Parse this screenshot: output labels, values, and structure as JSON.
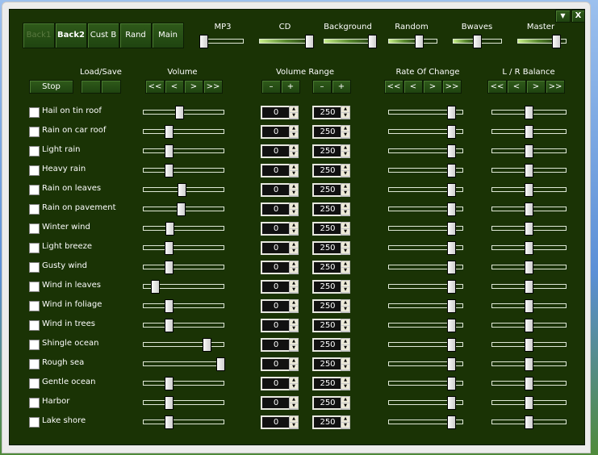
{
  "top_buttons": [
    {
      "label": "Back1",
      "disabled": true
    },
    {
      "label": "Back2",
      "bold": true
    },
    {
      "label": "Cust B"
    },
    {
      "label": "Rand"
    },
    {
      "label": "Main"
    }
  ],
  "window_controls": {
    "menu": "▼",
    "close": "X"
  },
  "mixer": [
    {
      "label": "MP3",
      "value": 0
    },
    {
      "label": "CD",
      "value": 100
    },
    {
      "label": "Background",
      "value": 100
    },
    {
      "label": "Random",
      "value": 65
    },
    {
      "label": "Bwaves",
      "value": 50
    },
    {
      "label": "Master",
      "value": 85
    }
  ],
  "controls": {
    "stop": "Stop",
    "load_save": "Load/Save",
    "volume": "Volume",
    "volume_range": "Volume Range",
    "rate_of_change": "Rate Of Change",
    "lr_balance": "L / R Balance",
    "nav": [
      "<<",
      "<",
      ">",
      ">>"
    ],
    "minus": "–",
    "plus": "+"
  },
  "spin_arrows": {
    "up": "▲",
    "down": "▼"
  },
  "sounds": [
    {
      "name": "Hail on tin roof",
      "checked": false,
      "volume": 45,
      "min": "0",
      "max": "250",
      "rate": 88,
      "balance": 50
    },
    {
      "name": "Rain on car roof",
      "checked": false,
      "volume": 30,
      "min": "0",
      "max": "250",
      "rate": 88,
      "balance": 50
    },
    {
      "name": "Light rain",
      "checked": false,
      "volume": 30,
      "min": "0",
      "max": "250",
      "rate": 88,
      "balance": 50
    },
    {
      "name": "Heavy rain",
      "checked": false,
      "volume": 30,
      "min": "0",
      "max": "250",
      "rate": 88,
      "balance": 50
    },
    {
      "name": "Rain on leaves",
      "checked": false,
      "volume": 48,
      "min": "0",
      "max": "250",
      "rate": 88,
      "balance": 50
    },
    {
      "name": "Rain on pavement",
      "checked": false,
      "volume": 47,
      "min": "0",
      "max": "250",
      "rate": 88,
      "balance": 50
    },
    {
      "name": "Winter wind",
      "checked": false,
      "volume": 31,
      "min": "0",
      "max": "250",
      "rate": 88,
      "balance": 50
    },
    {
      "name": "Light breeze",
      "checked": false,
      "volume": 30,
      "min": "0",
      "max": "250",
      "rate": 88,
      "balance": 50
    },
    {
      "name": "Gusty wind",
      "checked": false,
      "volume": 30,
      "min": "0",
      "max": "250",
      "rate": 88,
      "balance": 50
    },
    {
      "name": "Wind in leaves",
      "checked": false,
      "volume": 12,
      "min": "0",
      "max": "250",
      "rate": 88,
      "balance": 50
    },
    {
      "name": "Wind in foliage",
      "checked": false,
      "volume": 30,
      "min": "0",
      "max": "250",
      "rate": 88,
      "balance": 50
    },
    {
      "name": "Wind in trees",
      "checked": false,
      "volume": 30,
      "min": "0",
      "max": "250",
      "rate": 88,
      "balance": 50
    },
    {
      "name": "Shingle ocean",
      "checked": false,
      "volume": 82,
      "min": "0",
      "max": "250",
      "rate": 88,
      "balance": 50
    },
    {
      "name": "Rough sea",
      "checked": false,
      "volume": 100,
      "min": "0",
      "max": "250",
      "rate": 88,
      "balance": 50
    },
    {
      "name": "Gentle ocean",
      "checked": false,
      "volume": 30,
      "min": "0",
      "max": "250",
      "rate": 88,
      "balance": 50
    },
    {
      "name": "Harbor",
      "checked": false,
      "volume": 30,
      "min": "0",
      "max": "250",
      "rate": 88,
      "balance": 50
    },
    {
      "name": "Lake shore",
      "checked": false,
      "volume": 30,
      "min": "0",
      "max": "250",
      "rate": 88,
      "balance": 50
    }
  ],
  "colors": {
    "panel": "#1a3305",
    "button": "#2f5a1a"
  }
}
